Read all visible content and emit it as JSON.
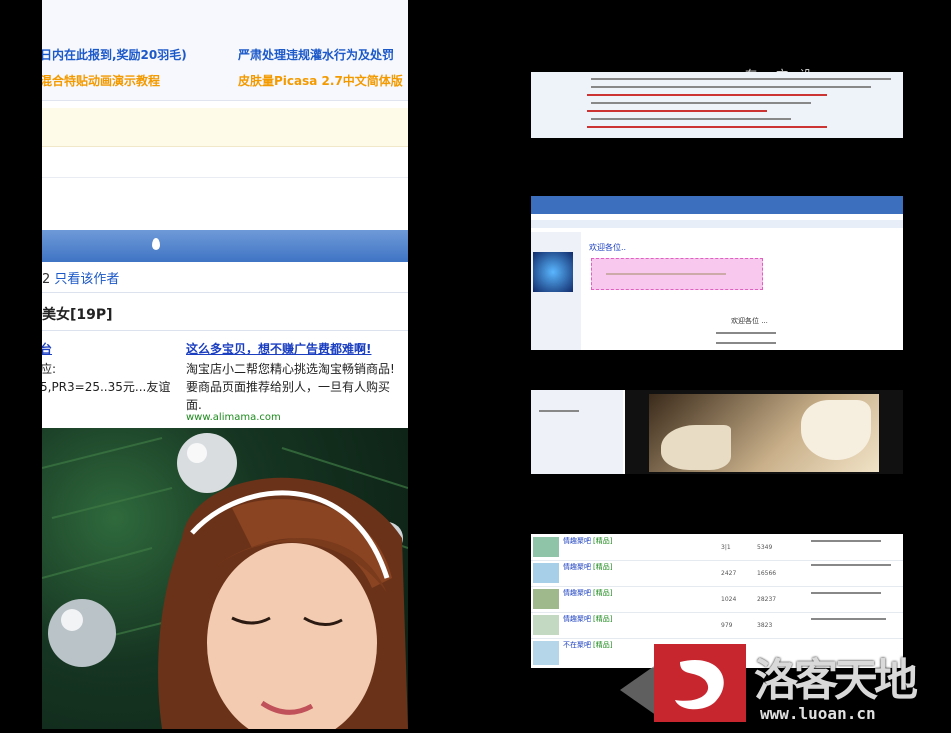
{
  "left": {
    "announcements": [
      {
        "text": "日内在此报到,奖励20羽毛)",
        "color": "blue"
      },
      {
        "text": "严肃处理违规灌水行为及处罚",
        "color": "blue"
      },
      {
        "text": "混合特贴动画演示教程",
        "color": "orange"
      },
      {
        "text": "皮肤量Picasa 2.7中文简体版",
        "color": "orange"
      }
    ],
    "post_meta": {
      "floor": "2",
      "only_author": "只看该作者"
    },
    "post_title": "美女[19P]",
    "ads": {
      "left_link": "台",
      "left_lines": [
        "应:",
        "5,PR3=25..35元...友谊"
      ],
      "right_link": "这么多宝贝，想不赚广告费都难啊!",
      "right_lines": [
        "淘宝店小二帮您精心挑选淘宝畅销商品!",
        "要商品页面推荐给别人，一旦有人购买",
        "面."
      ],
      "right_url": "www.alimama.com"
    }
  },
  "thumbs": {
    "t2": {
      "title": "欢迎各位..",
      "caption": "欢迎各位 ..."
    },
    "t4": {
      "rows": [
        {
          "title": "情趣聚吧",
          "tag": "[精品]",
          "views": "3|1",
          "replies": "5349"
        },
        {
          "title": "情趣聚吧",
          "tag": "[精品]",
          "views": "2427",
          "replies": "16566"
        },
        {
          "title": "情趣聚吧",
          "tag": "[精品]",
          "views": "1024",
          "replies": "28237"
        },
        {
          "title": "情趣聚吧",
          "tag": "[精品]",
          "views": "979",
          "replies": "3823"
        },
        {
          "title": "不在聚吧",
          "tag": "[精品]",
          "views": "",
          "replies": ""
        }
      ]
    }
  },
  "watermark": {
    "brand": "洛客天地",
    "url": "www.luoan.cn",
    "top_right_text": "在     文   设"
  },
  "colors": {
    "blue": "#1b58c8",
    "orange": "#f39a00",
    "forum_bar": "#3f74c4",
    "logo_red": "#c8262f"
  }
}
